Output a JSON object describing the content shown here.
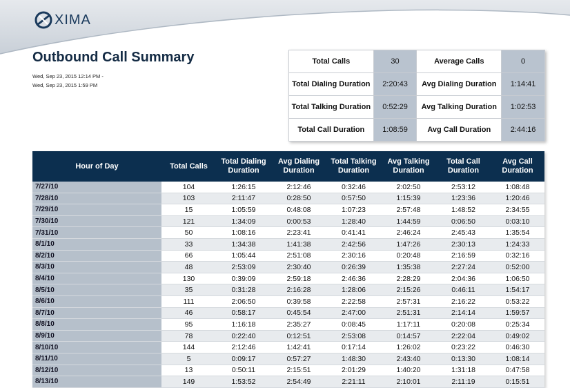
{
  "logo": {
    "text": "XIMA"
  },
  "report": {
    "title": "Outbound Call Summary",
    "date_start": "Wed, Sep 23, 2015 12:14 PM -",
    "date_end": "Wed, Sep 23, 2015 1:59 PM"
  },
  "summary": [
    {
      "label": "Total Calls",
      "value": "30",
      "label2": "Average Calls",
      "value2": "0"
    },
    {
      "label": "Total Dialing Duration",
      "value": "2:20:43",
      "label2": "Avg Dialing Duration",
      "value2": "1:14:41"
    },
    {
      "label": "Total Talking Duration",
      "value": "0:52:29",
      "label2": "Avg Talking Duration",
      "value2": "1:02:53"
    },
    {
      "label": "Total Call Duration",
      "value": "1:08:59",
      "label2": "Avg Call Duration",
      "value2": "2:44:16"
    }
  ],
  "table": {
    "columns": [
      "Hour of Day",
      "Total Calls",
      "Total Dialing Duration",
      "Avg Dialing Duration",
      "Total Talking Duration",
      "Avg Talking Duration",
      "Total Call Duration",
      "Avg Call Duration"
    ],
    "rows": [
      [
        "7/27/10",
        "104",
        "1:26:15",
        "2:12:46",
        "0:32:46",
        "2:02:50",
        "2:53:12",
        "1:08:48"
      ],
      [
        "7/28/10",
        "103",
        "2:11:47",
        "0:28:50",
        "0:57:50",
        "1:15:39",
        "1:23:36",
        "1:20:46"
      ],
      [
        "7/29/10",
        "15",
        "1:05:59",
        "0:48:08",
        "1:07:23",
        "2:57:48",
        "1:48:52",
        "2:34:55"
      ],
      [
        "7/30/10",
        "121",
        "1:34:09",
        "0:00:53",
        "1:28:40",
        "1:44:59",
        "0:06:50",
        "0:03:10"
      ],
      [
        "7/31/10",
        "50",
        "1:08:16",
        "2:23:41",
        "0:41:41",
        "2:46:24",
        "2:45:43",
        "1:35:54"
      ],
      [
        "8/1/10",
        "33",
        "1:34:38",
        "1:41:38",
        "2:42:56",
        "1:47:26",
        "2:30:13",
        "1:24:33"
      ],
      [
        "8/2/10",
        "66",
        "1:05:44",
        "2:51:08",
        "2:30:16",
        "0:20:48",
        "2:16:59",
        "0:32:16"
      ],
      [
        "8/3/10",
        "48",
        "2:53:09",
        "2:30:40",
        "0:26:39",
        "1:35:38",
        "2:27:24",
        "0:52:00"
      ],
      [
        "8/4/10",
        "130",
        "0:39:09",
        "2:59:18",
        "2:46:36",
        "2:28:29",
        "2:04:36",
        "1:06:50"
      ],
      [
        "8/5/10",
        "35",
        "0:31:28",
        "2:16:28",
        "1:28:06",
        "2:15:26",
        "0:46:11",
        "1:54:17"
      ],
      [
        "8/6/10",
        "111",
        "2:06:50",
        "0:39:58",
        "2:22:58",
        "2:57:31",
        "2:16:22",
        "0:53:22"
      ],
      [
        "8/7/10",
        "46",
        "0:58:17",
        "0:45:54",
        "2:47:00",
        "2:51:31",
        "2:14:14",
        "1:59:57"
      ],
      [
        "8/8/10",
        "95",
        "1:16:18",
        "2:35:27",
        "0:08:45",
        "1:17:11",
        "0:20:08",
        "0:25:34"
      ],
      [
        "8/9/10",
        "78",
        "0:22:40",
        "0:12:51",
        "2:53:08",
        "0:14:57",
        "2:22:04",
        "0:49:02"
      ],
      [
        "8/10/10",
        "144",
        "2:12:46",
        "1:42:41",
        "0:17:14",
        "1:26:02",
        "0:23:22",
        "0:46:30"
      ],
      [
        "8/11/10",
        "5",
        "0:09:17",
        "0:57:27",
        "1:48:30",
        "2:43:40",
        "0:13:30",
        "1:08:14"
      ],
      [
        "8/12/10",
        "13",
        "0:50:11",
        "2:15:51",
        "2:01:29",
        "1:40:20",
        "1:31:18",
        "0:47:58"
      ],
      [
        "8/13/10",
        "149",
        "1:53:52",
        "2:54:49",
        "2:21:11",
        "2:10:01",
        "2:11:19",
        "0:15:51"
      ]
    ]
  }
}
